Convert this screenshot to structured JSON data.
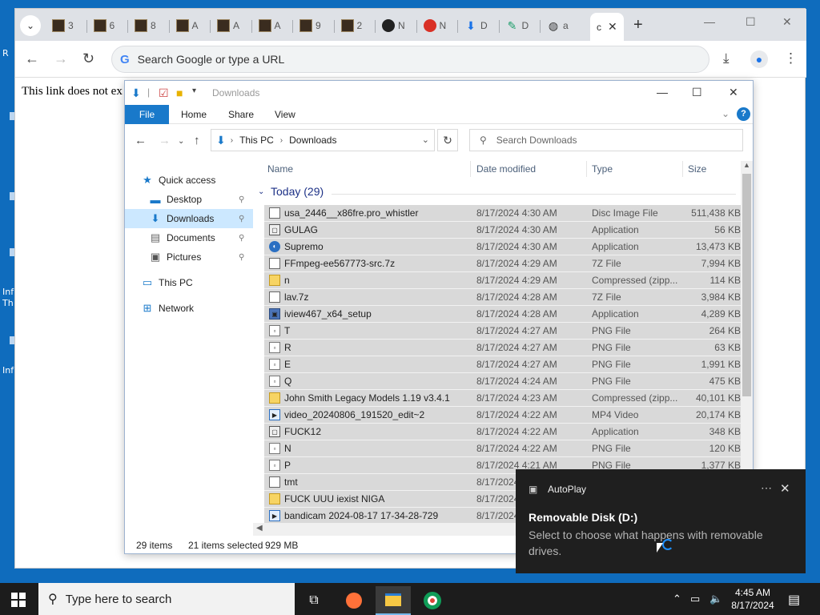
{
  "desktop": {
    "fragments": [
      "R",
      "Inf",
      "Th",
      "Inf"
    ]
  },
  "browser": {
    "tabs": [
      {
        "label": "3",
        "favicon": "thumbnail"
      },
      {
        "label": "6",
        "favicon": "thumbnail"
      },
      {
        "label": "8",
        "favicon": "thumbnail"
      },
      {
        "label": "A",
        "favicon": "thumbnail"
      },
      {
        "label": "A",
        "favicon": "thumbnail"
      },
      {
        "label": "A",
        "favicon": "thumbnail"
      },
      {
        "label": "9",
        "favicon": "thumbnail"
      },
      {
        "label": "2",
        "favicon": "thumbnail"
      },
      {
        "label": "N",
        "favicon": "github"
      },
      {
        "label": "N",
        "favicon": "red-m"
      },
      {
        "label": "D",
        "favicon": "download"
      },
      {
        "label": "D",
        "favicon": "green"
      },
      {
        "label": "a",
        "favicon": "globe"
      }
    ],
    "active_tab": {
      "label": "c"
    },
    "omnibox": {
      "placeholder": "Search Google or type a URL"
    },
    "page_text": "This link does not ex"
  },
  "explorer": {
    "title": "Downloads",
    "ribbon_tabs": [
      "File",
      "Home",
      "Share",
      "View"
    ],
    "address": {
      "crumbs": [
        "This PC",
        "Downloads"
      ]
    },
    "search_placeholder": "Search Downloads",
    "nav": [
      {
        "label": "Quick access",
        "icon": "star-icon"
      },
      {
        "label": "Desktop",
        "icon": "desktop-icon",
        "pinned": true
      },
      {
        "label": "Downloads",
        "icon": "download-icon",
        "pinned": true,
        "selected": true
      },
      {
        "label": "Documents",
        "icon": "document-icon",
        "pinned": true
      },
      {
        "label": "Pictures",
        "icon": "picture-icon",
        "pinned": true
      },
      {
        "label": "This PC",
        "icon": "computer-icon"
      },
      {
        "label": "Network",
        "icon": "network-icon"
      }
    ],
    "columns": {
      "name": "Name",
      "date": "Date modified",
      "type": "Type",
      "size": "Size"
    },
    "group": "Today (29)",
    "files": [
      {
        "name": "usa_2446__x86fre.pro_whistler",
        "date": "8/17/2024 4:30 AM",
        "type": "Disc Image File",
        "size": "511,438 KB",
        "icon": "disc"
      },
      {
        "name": "GULAG",
        "date": "8/17/2024 4:30 AM",
        "type": "Application",
        "size": "56 KB",
        "icon": "app"
      },
      {
        "name": "Supremo",
        "date": "8/17/2024 4:30 AM",
        "type": "Application",
        "size": "13,473 KB",
        "icon": "app2"
      },
      {
        "name": "FFmpeg-ee567773-src.7z",
        "date": "8/17/2024 4:29 AM",
        "type": "7Z File",
        "size": "7,994 KB",
        "icon": "7z"
      },
      {
        "name": "n",
        "date": "8/17/2024 4:29 AM",
        "type": "Compressed (zipp...",
        "size": "114 KB",
        "icon": "zip"
      },
      {
        "name": "lav.7z",
        "date": "8/17/2024 4:28 AM",
        "type": "7Z File",
        "size": "3,984 KB",
        "icon": "7z"
      },
      {
        "name": "iview467_x64_setup",
        "date": "8/17/2024 4:28 AM",
        "type": "Application",
        "size": "4,289 KB",
        "icon": "setup"
      },
      {
        "name": "T",
        "date": "8/17/2024 4:27 AM",
        "type": "PNG File",
        "size": "264 KB",
        "icon": "png"
      },
      {
        "name": "R",
        "date": "8/17/2024 4:27 AM",
        "type": "PNG File",
        "size": "63 KB",
        "icon": "png"
      },
      {
        "name": "E",
        "date": "8/17/2024 4:27 AM",
        "type": "PNG File",
        "size": "1,991 KB",
        "icon": "png"
      },
      {
        "name": "Q",
        "date": "8/17/2024 4:24 AM",
        "type": "PNG File",
        "size": "475 KB",
        "icon": "png"
      },
      {
        "name": "John Smith Legacy Models 1.19 v3.4.1",
        "date": "8/17/2024 4:23 AM",
        "type": "Compressed (zipp...",
        "size": "40,101 KB",
        "icon": "zip"
      },
      {
        "name": "video_20240806_191520_edit~2",
        "date": "8/17/2024 4:22 AM",
        "type": "MP4 Video",
        "size": "20,174 KB",
        "icon": "mp4"
      },
      {
        "name": "FUCK12",
        "date": "8/17/2024 4:22 AM",
        "type": "Application",
        "size": "348 KB",
        "icon": "app"
      },
      {
        "name": "N",
        "date": "8/17/2024 4:22 AM",
        "type": "PNG File",
        "size": "120 KB",
        "icon": "png"
      },
      {
        "name": "P",
        "date": "8/17/2024 4:21 AM",
        "type": "PNG File",
        "size": "1,377 KB",
        "icon": "png"
      },
      {
        "name": "tmt",
        "date": "8/17/2024",
        "type": "",
        "size": "",
        "icon": "disc"
      },
      {
        "name": "FUCK UUU iexist NIGA",
        "date": "8/17/2024",
        "type": "",
        "size": "",
        "icon": "zip"
      },
      {
        "name": "bandicam 2024-08-17 17-34-28-729",
        "date": "8/17/2024",
        "type": "",
        "size": "",
        "icon": "mp4"
      }
    ],
    "status": {
      "items": "29 items",
      "selected": "21 items selected",
      "size": "929 MB"
    }
  },
  "toast": {
    "app": "AutoPlay",
    "title": "Removable Disk (D:)",
    "body": "Select to choose what happens with removable drives."
  },
  "taskbar": {
    "search_placeholder": "Type here to search",
    "time": "4:45 AM",
    "date": "8/17/2024"
  },
  "colors": {
    "explorer_accent": "#1979ca",
    "selection": "#d9d9d9",
    "toast_bg": "#1f1f1f",
    "taskbar_bg": "#1c1c1c"
  }
}
